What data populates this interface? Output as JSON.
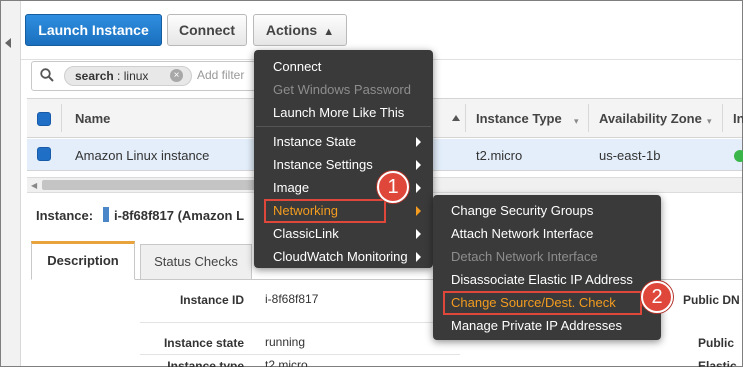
{
  "toolbar": {
    "launch_label": "Launch Instance",
    "connect_label": "Connect",
    "actions_label": "Actions",
    "actions_caret": "^"
  },
  "search": {
    "token_key": "search",
    "token_sep": ":",
    "token_value": "linux",
    "token_close": "×",
    "placeholder": "Add filter"
  },
  "table": {
    "headers": [
      "Name",
      "Instance Type",
      "Availability Zone",
      "In"
    ],
    "rows": [
      {
        "name": "Amazon Linux instance",
        "instance_type": "t2.micro",
        "availability_zone": "us-east-1b"
      }
    ],
    "status_color": "#39b54a"
  },
  "instance": {
    "label": "Instance:",
    "id_text": "i-8f68f817 (Amazon L"
  },
  "tabs": [
    {
      "label": "Description",
      "active": true
    },
    {
      "label": "Status Checks",
      "active": false
    }
  ],
  "details": [
    {
      "label": "Instance ID",
      "value": "i-8f68f817"
    },
    {
      "label": "Instance state",
      "value": "running"
    },
    {
      "label": "Instance type",
      "value": "t2.micro"
    }
  ],
  "details_right": [
    "Public DN",
    "Public",
    "Elastic"
  ],
  "actions_menu": {
    "items": [
      {
        "label": "Connect",
        "disabled": false,
        "submenu": false
      },
      {
        "label": "Get Windows Password",
        "disabled": true,
        "submenu": false
      },
      {
        "label": "Launch More Like This",
        "disabled": false,
        "submenu": false
      },
      {
        "label": "Instance State",
        "disabled": false,
        "submenu": true
      },
      {
        "label": "Instance Settings",
        "disabled": false,
        "submenu": true
      },
      {
        "label": "Image",
        "disabled": false,
        "submenu": true
      },
      {
        "label": "Networking",
        "disabled": false,
        "submenu": true,
        "highlighted": true
      },
      {
        "label": "ClassicLink",
        "disabled": false,
        "submenu": true
      },
      {
        "label": "CloudWatch Monitoring",
        "disabled": false,
        "submenu": true
      }
    ]
  },
  "networking_submenu": {
    "items": [
      {
        "label": "Change Security Groups",
        "disabled": false
      },
      {
        "label": "Attach Network Interface",
        "disabled": false
      },
      {
        "label": "Detach Network Interface",
        "disabled": true
      },
      {
        "label": "Disassociate Elastic IP Address",
        "disabled": false
      },
      {
        "label": "Change Source/Dest. Check",
        "disabled": false,
        "highlighted": true
      },
      {
        "label": "Manage Private IP Addresses",
        "disabled": false
      }
    ]
  },
  "callouts": [
    "1",
    "2"
  ],
  "colors": {
    "primary_button": "#1f77c9",
    "menu_bg": "#3a3a3a",
    "menu_highlight": "#f39c1f",
    "callout_red": "#e0473b",
    "tab_accent": "#e8a33d"
  }
}
